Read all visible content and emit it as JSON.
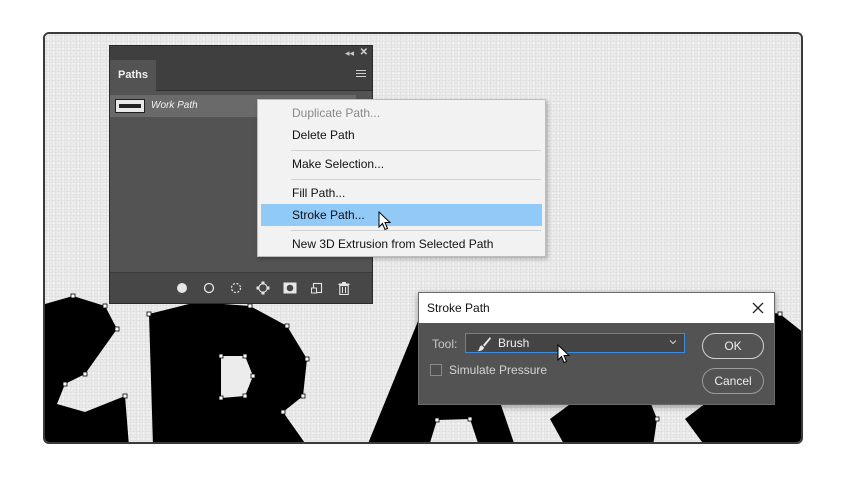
{
  "paths_panel": {
    "collapse_glyph": "◂◂",
    "close_glyph": "✕",
    "tab_label": "Paths",
    "work_path_name": "Work Path",
    "bottom_icons": [
      "fill-path-icon",
      "stroke-path-icon",
      "load-selection-icon",
      "make-work-path-icon",
      "add-mask-icon",
      "new-path-icon",
      "trash-icon"
    ]
  },
  "context_menu": {
    "items": [
      {
        "label": "Duplicate Path...",
        "state": "disabled"
      },
      {
        "label": "Delete Path",
        "state": "normal"
      },
      {
        "label": "Make Selection...",
        "state": "normal"
      },
      {
        "label": "Fill Path...",
        "state": "normal"
      },
      {
        "label": "Stroke Path...",
        "state": "highlighted"
      },
      {
        "label": "New 3D Extrusion from Selected Path",
        "state": "normal"
      }
    ]
  },
  "stroke_dialog": {
    "title": "Stroke Path",
    "tool_label": "Tool:",
    "tool_value": "Brush",
    "simulate_pressure_label": "Simulate Pressure",
    "simulate_pressure_checked": false,
    "ok_label": "OK",
    "cancel_label": "Cancel"
  },
  "colors": {
    "highlight": "#91c9f7",
    "panel_bg": "#535353",
    "focus_border": "#3d8be0"
  }
}
